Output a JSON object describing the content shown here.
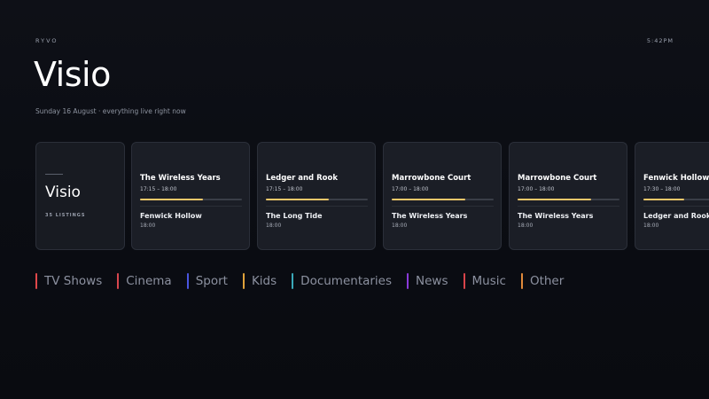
{
  "header": {
    "brand": "RYVO",
    "clock": "5:42PM",
    "title": "Visio",
    "subtitle": "Sunday 16 August · everything live right now"
  },
  "summary": {
    "name": "Visio",
    "count": "35 LISTINGS"
  },
  "channels": [
    {
      "now": {
        "title": "The Wireless Years",
        "time": "17:15 – 18:00",
        "progress": 0.62
      },
      "next": {
        "title": "Fenwick Hollow",
        "time": "18:00"
      }
    },
    {
      "now": {
        "title": "Ledger and Rook",
        "time": "17:15 – 18:00",
        "progress": 0.62
      },
      "next": {
        "title": "The Long Tide",
        "time": "18:00"
      }
    },
    {
      "now": {
        "title": "Marrowbone Court",
        "time": "17:00 – 18:00",
        "progress": 0.72
      },
      "next": {
        "title": "The Wireless Years",
        "time": "18:00"
      }
    },
    {
      "now": {
        "title": "Marrowbone Court",
        "time": "17:00 – 18:00",
        "progress": 0.72
      },
      "next": {
        "title": "The Wireless Years",
        "time": "18:00"
      }
    },
    {
      "now": {
        "title": "Fenwick Hollow",
        "time": "17:30 – 18:00",
        "progress": 0.4
      },
      "next": {
        "title": "Ledger and Rook",
        "time": "18:00"
      }
    }
  ],
  "categories": [
    {
      "label": "TV Shows",
      "color": "#e0484a"
    },
    {
      "label": "Cinema",
      "color": "#d9464e"
    },
    {
      "label": "Sport",
      "color": "#4a56e0"
    },
    {
      "label": "Kids",
      "color": "#e0a33a"
    },
    {
      "label": "Documentaries",
      "color": "#3aa9b8"
    },
    {
      "label": "News",
      "color": "#8a3ad9"
    },
    {
      "label": "Music",
      "color": "#d9444a"
    },
    {
      "label": "Other",
      "color": "#e08a3a"
    }
  ],
  "colors": {
    "background": "#0b0d13",
    "card": "#1b1e26",
    "progress": "#f2c86a"
  }
}
